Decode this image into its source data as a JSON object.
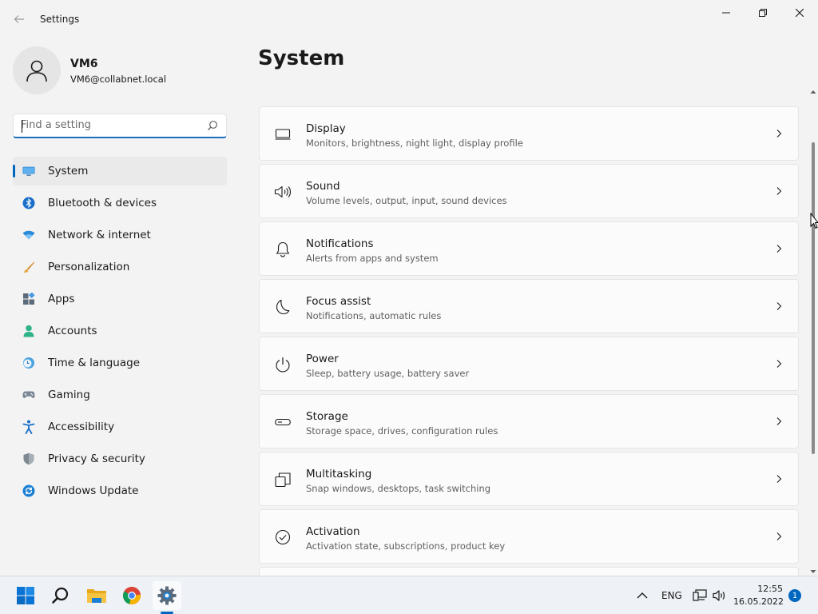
{
  "window": {
    "title": "Settings",
    "back_icon": "back-arrow-icon",
    "controls": [
      "minimize",
      "maximize",
      "close"
    ]
  },
  "profile": {
    "name": "VM6",
    "email": "VM6@collabnet.local"
  },
  "search": {
    "placeholder": "Find a setting",
    "value": ""
  },
  "nav": {
    "items": [
      {
        "label": "System",
        "icon": "system-icon",
        "active": true
      },
      {
        "label": "Bluetooth & devices",
        "icon": "bluetooth-icon"
      },
      {
        "label": "Network & internet",
        "icon": "network-icon"
      },
      {
        "label": "Personalization",
        "icon": "brush-icon"
      },
      {
        "label": "Apps",
        "icon": "apps-icon"
      },
      {
        "label": "Accounts",
        "icon": "accounts-icon"
      },
      {
        "label": "Time & language",
        "icon": "time-language-icon"
      },
      {
        "label": "Gaming",
        "icon": "gamepad-icon"
      },
      {
        "label": "Accessibility",
        "icon": "accessibility-icon"
      },
      {
        "label": "Privacy & security",
        "icon": "shield-icon"
      },
      {
        "label": "Windows Update",
        "icon": "windows-update-icon"
      }
    ]
  },
  "main": {
    "title": "System",
    "cards": [
      {
        "title": "Display",
        "subtitle": "Monitors, brightness, night light, display profile",
        "icon": "monitor-icon"
      },
      {
        "title": "Sound",
        "subtitle": "Volume levels, output, input, sound devices",
        "icon": "speaker-icon"
      },
      {
        "title": "Notifications",
        "subtitle": "Alerts from apps and system",
        "icon": "bell-icon"
      },
      {
        "title": "Focus assist",
        "subtitle": "Notifications, automatic rules",
        "icon": "moon-icon"
      },
      {
        "title": "Power",
        "subtitle": "Sleep, battery usage, battery saver",
        "icon": "power-icon"
      },
      {
        "title": "Storage",
        "subtitle": "Storage space, drives, configuration rules",
        "icon": "storage-icon"
      },
      {
        "title": "Multitasking",
        "subtitle": "Snap windows, desktops, task switching",
        "icon": "multitasking-icon"
      },
      {
        "title": "Activation",
        "subtitle": "Activation state, subscriptions, product key",
        "icon": "activation-check-icon"
      }
    ]
  },
  "taskbar": {
    "apps": [
      "start-icon",
      "search-icon",
      "file-explorer-icon",
      "chrome-icon",
      "settings-gear-icon"
    ],
    "active_app": "settings-gear-icon",
    "language": "ENG",
    "time": "12:55",
    "date": "16.05.2022",
    "notification_count": "1"
  },
  "colors": {
    "accent": "#0067c0",
    "window_bg": "#f3f3f3",
    "card_bg": "#fbfbfb"
  }
}
